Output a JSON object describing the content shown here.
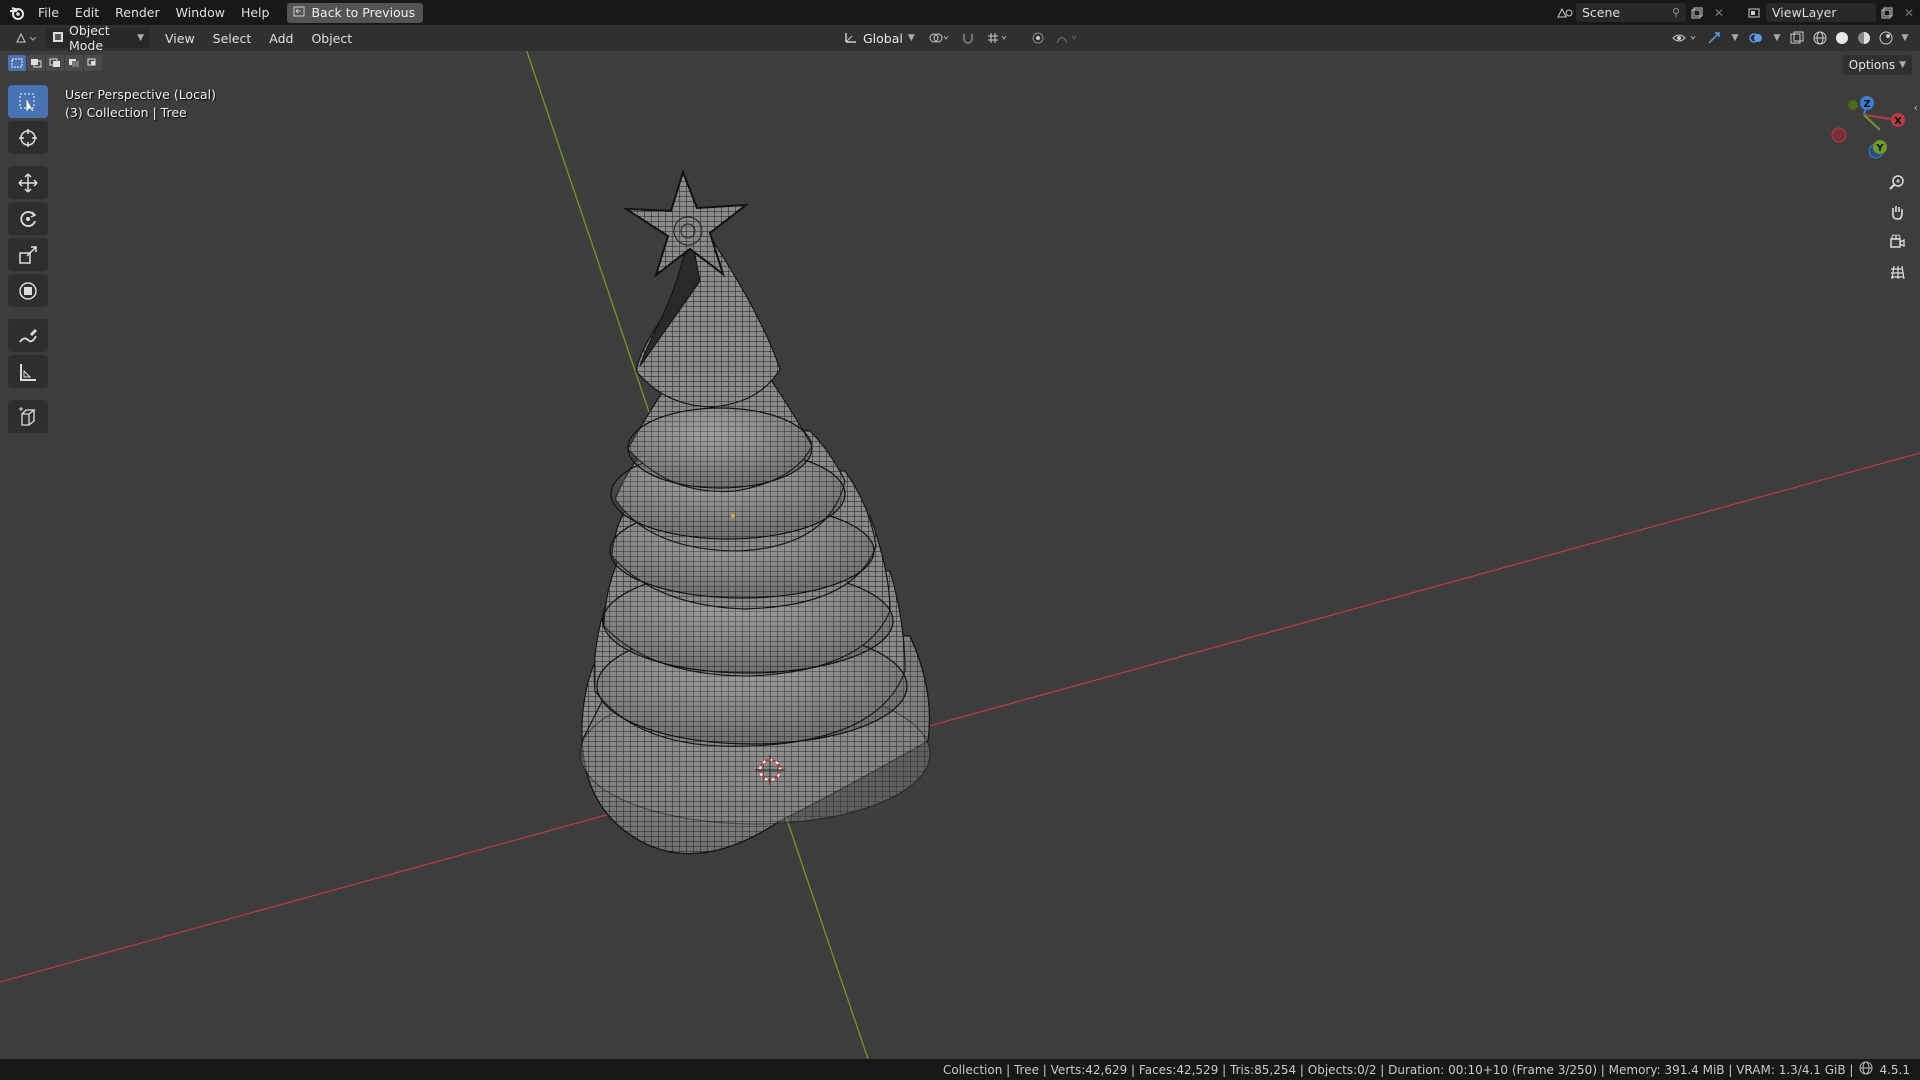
{
  "topbar": {
    "menus": [
      "File",
      "Edit",
      "Render",
      "Window",
      "Help"
    ],
    "back_button": "Back to Previous",
    "scene": "Scene",
    "view_layer": "ViewLayer"
  },
  "header": {
    "mode": "Object Mode",
    "menus": [
      "View",
      "Select",
      "Add",
      "Object"
    ],
    "orientation": "Global",
    "options": "Options"
  },
  "toolbar": {
    "tools": [
      "select-box",
      "cursor",
      "move",
      "rotate",
      "scale",
      "transform",
      "annotate",
      "measure",
      "add-cube"
    ],
    "active": "select-box"
  },
  "viewport": {
    "view_name": "User Perspective (Local)",
    "collection_info": "(3) Collection | Tree"
  },
  "gizmo": {
    "x": "X",
    "y": "Y",
    "z": "Z"
  },
  "statusbar": {
    "text": "Collection | Tree | Verts:42,629 | Faces:42,529 | Tris:85,254 | Objects:0/2 | Duration: 00:10+10 (Frame 3/250) | Memory: 391.4 MiB | VRAM: 1.3/4.1 GiB |",
    "version": "4.5.1"
  },
  "colors": {
    "accent": "#4772b3",
    "x_axis": "#b53d45",
    "y_axis": "#6f9a25",
    "z_axis": "#3b7fd6"
  }
}
